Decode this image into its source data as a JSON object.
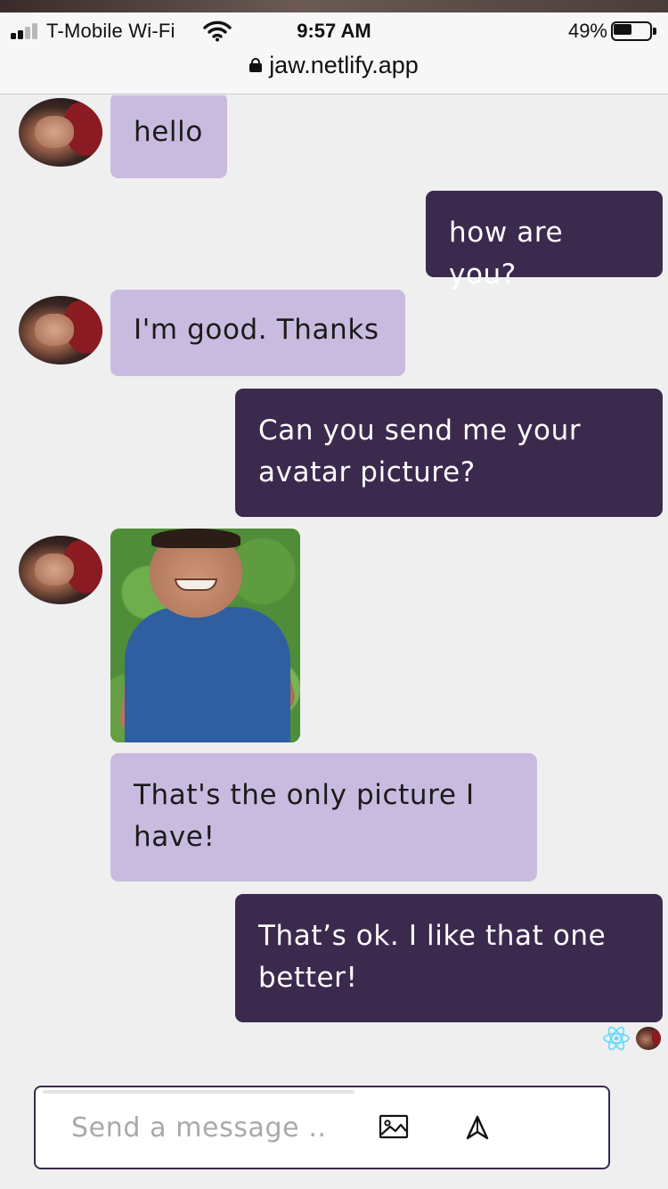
{
  "status_bar": {
    "carrier": "T-Mobile Wi-Fi",
    "time": "9:57 AM",
    "battery_percent": "49%",
    "battery_level": 0.49,
    "signal_bars_filled": 2,
    "signal_bars_total": 4
  },
  "browser": {
    "url": "jaw.netlify.app"
  },
  "messages": [
    {
      "side": "incoming",
      "lines": [
        "hello"
      ]
    },
    {
      "side": "outgoing",
      "lines": [
        "how are you?"
      ]
    },
    {
      "side": "incoming",
      "lines": [
        "I'm good. Thanks"
      ]
    },
    {
      "side": "outgoing",
      "lines": [
        "Can you send me your",
        "avatar picture?"
      ]
    },
    {
      "side": "incoming",
      "type": "image"
    },
    {
      "side": "incoming",
      "lines": [
        "That's the only picture I",
        "have!"
      ]
    },
    {
      "side": "outgoing",
      "lines": [
        "That’s ok. I like that one",
        "better!"
      ]
    }
  ],
  "composer": {
    "placeholder": "Send a message ..",
    "value": "",
    "image_button_icon": "image-icon",
    "send_button_icon": "send-arrow-icon"
  },
  "colors": {
    "incoming_bubble": "#c9bbdf",
    "outgoing_bubble": "#3b2a4e",
    "background": "#efefef",
    "react_icon": "#61dafb"
  }
}
